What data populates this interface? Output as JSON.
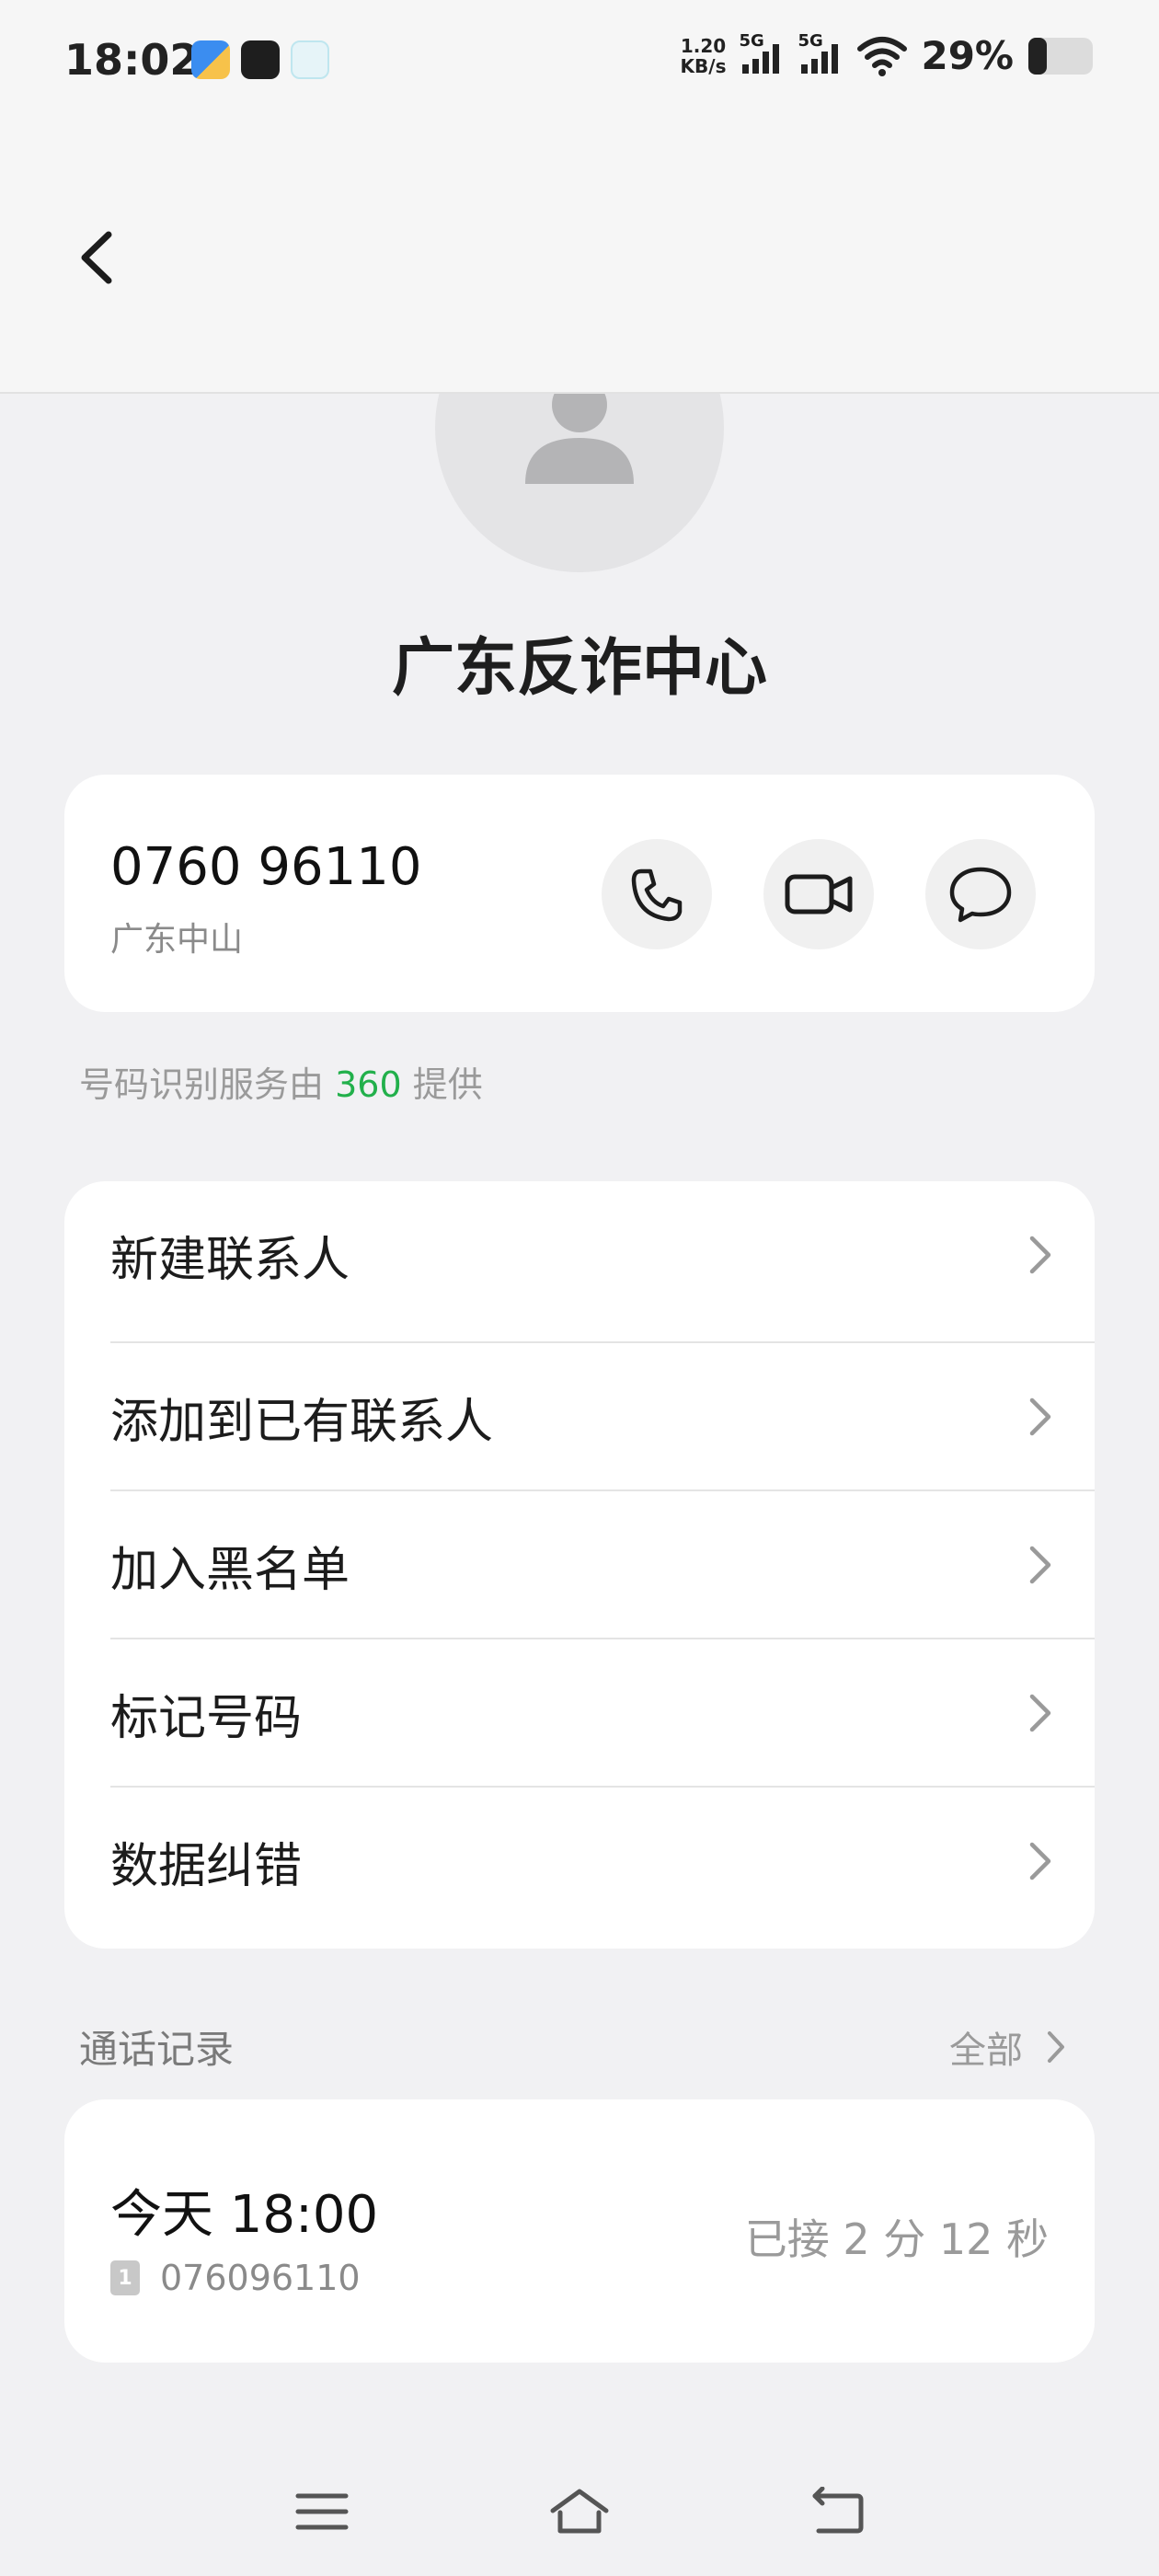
{
  "status_bar": {
    "time": "18:02",
    "speed_value": "1.20",
    "speed_unit": "KB/s",
    "signal1_label": "5G",
    "signal2_label": "5G",
    "battery": "29%",
    "notification_icons": [
      "files-app-icon",
      "soul-app-icon",
      "mm-app-icon"
    ]
  },
  "contact": {
    "name": "广东反诈中心",
    "phone_number": "0760 96110",
    "location": "广东中山"
  },
  "provider": {
    "prefix": "号码识别服务由",
    "brand": "360",
    "suffix": "提供",
    "brand_color": "#22b04b"
  },
  "menu": {
    "items": [
      {
        "label": "新建联系人"
      },
      {
        "label": "添加到已有联系人"
      },
      {
        "label": "加入黑名单"
      },
      {
        "label": "标记号码"
      },
      {
        "label": "数据纠错"
      }
    ]
  },
  "call_log": {
    "section_title": "通话记录",
    "see_all_label": "全部",
    "entries": [
      {
        "time": "今天 18:00",
        "sim": "1",
        "number": "076096110",
        "status": "已接 2 分 12 秒"
      }
    ]
  }
}
